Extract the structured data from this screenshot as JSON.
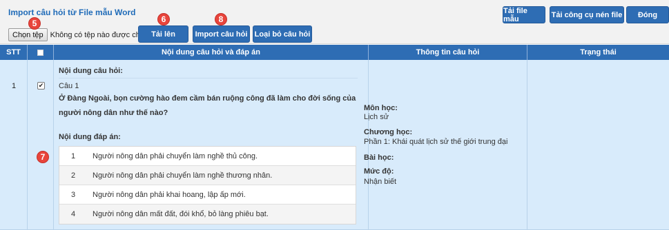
{
  "panel": {
    "title": "Import câu hỏi từ File mẫu Word"
  },
  "toolbar": {
    "download_template": "Tải file mẫu",
    "download_tool": "Tải công cụ nén file",
    "close": "Đóng",
    "upload": "Tải lên",
    "import_questions": "Import câu hỏi",
    "remove_questions": "Loại bỏ câu hỏi"
  },
  "file_input": {
    "button_label": "Chọn tệp",
    "status": "Không có tệp nào được chọn"
  },
  "markers": {
    "m5": "5",
    "m6": "6",
    "m7": "7",
    "m8": "8"
  },
  "table": {
    "headers": {
      "stt": "STT",
      "content": "Nội dung câu hỏi và đáp án",
      "info": "Thông tin câu hỏi",
      "status": "Trạng thái"
    },
    "rows": [
      {
        "stt": "1",
        "checked": true,
        "checkmark": "✔",
        "question_label": "Nội dung câu hỏi:",
        "question_number": "Câu 1",
        "question_text": "Ở Đàng Ngoài, bọn cường hào đem cầm bán ruộng công đã làm cho đời sống của người nông dân như thế nào?",
        "answers_label": "Nội dung đáp án:",
        "answers": [
          {
            "num": "1",
            "text": "Người nông dân phải chuyển làm nghề thủ công."
          },
          {
            "num": "2",
            "text": "Người nông dân phải chuyển làm nghề thương nhân."
          },
          {
            "num": "3",
            "text": "Người nông dân phải khai hoang, lập ấp mới."
          },
          {
            "num": "4",
            "text": "Người nông dân mất đất, đói khổ, bỏ làng phiêu bạt."
          }
        ],
        "info": {
          "subject_label": "Môn học:",
          "subject": "Lịch sử",
          "chapter_label": "Chương học:",
          "chapter": "Phần 1: Khái quát lịch sử thế giới trung đại",
          "lesson_label": "Bài học:",
          "level_label": "Mức độ:",
          "level": "Nhận biết"
        },
        "status": ""
      }
    ]
  },
  "colors": {
    "header_bg": "#2e6db4",
    "row_bg": "#d8ebfb",
    "marker": "#e8453c",
    "title": "#1f6bb8"
  }
}
